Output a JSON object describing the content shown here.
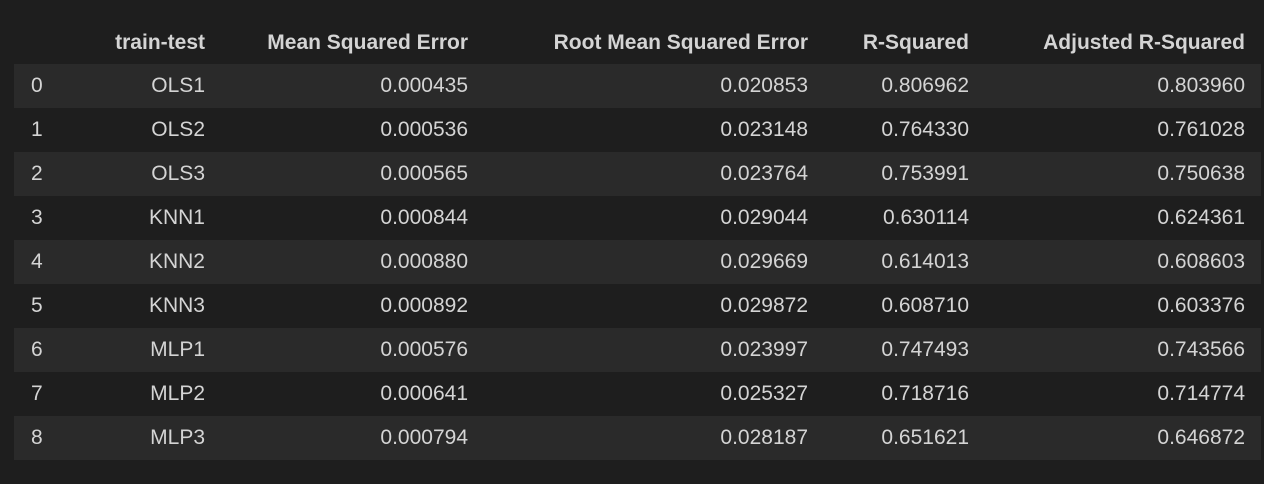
{
  "table": {
    "columns": [
      "",
      "train-test",
      "Mean Squared Error",
      "Root Mean Squared Error",
      "R-Squared",
      "Adjusted R-Squared"
    ],
    "rows": [
      {
        "index": "0",
        "train_test": "OLS1",
        "mse": "0.000435",
        "rmse": "0.020853",
        "r2": "0.806962",
        "adj_r2": "0.803960"
      },
      {
        "index": "1",
        "train_test": "OLS2",
        "mse": "0.000536",
        "rmse": "0.023148",
        "r2": "0.764330",
        "adj_r2": "0.761028"
      },
      {
        "index": "2",
        "train_test": "OLS3",
        "mse": "0.000565",
        "rmse": "0.023764",
        "r2": "0.753991",
        "adj_r2": "0.750638"
      },
      {
        "index": "3",
        "train_test": "KNN1",
        "mse": "0.000844",
        "rmse": "0.029044",
        "r2": "0.630114",
        "adj_r2": "0.624361"
      },
      {
        "index": "4",
        "train_test": "KNN2",
        "mse": "0.000880",
        "rmse": "0.029669",
        "r2": "0.614013",
        "adj_r2": "0.608603"
      },
      {
        "index": "5",
        "train_test": "KNN3",
        "mse": "0.000892",
        "rmse": "0.029872",
        "r2": "0.608710",
        "adj_r2": "0.603376"
      },
      {
        "index": "6",
        "train_test": "MLP1",
        "mse": "0.000576",
        "rmse": "0.023997",
        "r2": "0.747493",
        "adj_r2": "0.743566"
      },
      {
        "index": "7",
        "train_test": "MLP2",
        "mse": "0.000641",
        "rmse": "0.025327",
        "r2": "0.718716",
        "adj_r2": "0.714774"
      },
      {
        "index": "8",
        "train_test": "MLP3",
        "mse": "0.000794",
        "rmse": "0.028187",
        "r2": "0.651621",
        "adj_r2": "0.646872"
      }
    ]
  },
  "colors": {
    "background": "#1e1e1e",
    "row_stripe": "#2a2a2a",
    "text": "#d4d4d4"
  }
}
